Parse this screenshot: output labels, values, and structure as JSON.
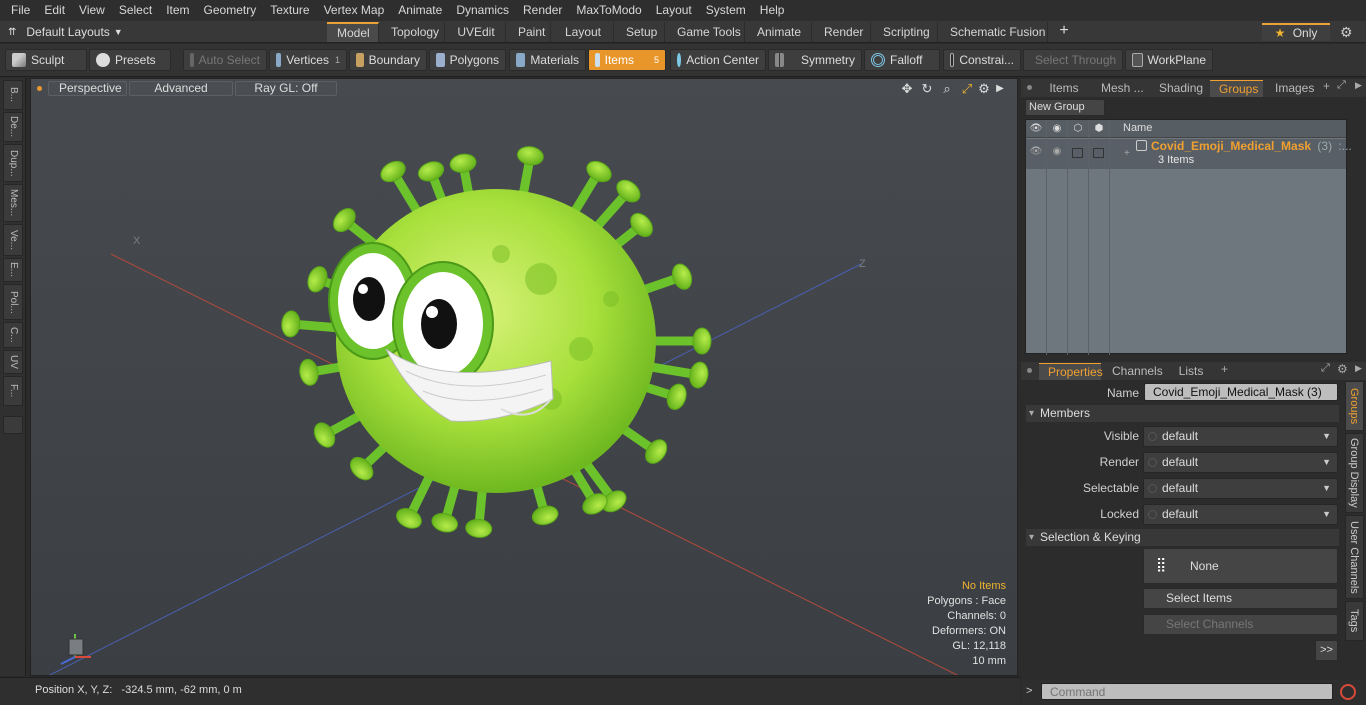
{
  "menu": [
    "File",
    "Edit",
    "View",
    "Select",
    "Item",
    "Geometry",
    "Texture",
    "Vertex Map",
    "Animate",
    "Dynamics",
    "Render",
    "MaxToModo",
    "Layout",
    "System",
    "Help"
  ],
  "layouts": {
    "label": "Default Layouts"
  },
  "layout_tabs": [
    "Model",
    "Topology",
    "UVEdit",
    "Paint",
    "Layout",
    "Setup",
    "Game Tools",
    "Animate",
    "Render",
    "Scripting",
    "Schematic Fusion"
  ],
  "only_label": "Only",
  "toolbar": {
    "sculpt": "Sculpt",
    "presets": "Presets",
    "auto_select": "Auto Select",
    "vertices": "Vertices",
    "vertices_count": "1",
    "boundary": "Boundary",
    "polygons": "Polygons",
    "materials": "Materials",
    "items": "Items",
    "items_count": "5",
    "action_center": "Action Center",
    "symmetry": "Symmetry",
    "falloff": "Falloff",
    "constraints": "Constrai...",
    "select_through": "Select Through",
    "workplane": "WorkPlane"
  },
  "left_tabs": [
    "B...",
    "De...",
    "Dup...",
    "Mes...",
    "Ve...",
    "E...",
    "Pol...",
    "C...",
    "UV",
    "F..."
  ],
  "viewport": {
    "perspective": "Perspective",
    "advanced": "Advanced",
    "raygl": "Ray GL: Off",
    "stats": {
      "items": "No Items",
      "polygons": "Polygons : Face",
      "channels": "Channels: 0",
      "deformers": "Deformers: ON",
      "gl": "GL: 12,118",
      "scale": "10 mm"
    }
  },
  "status": {
    "position": "Position X, Y, Z:   -324.5 mm, -62 mm, 0 m"
  },
  "right": {
    "top_tabs": [
      "Items",
      "Mesh ...",
      "Shading",
      "Groups",
      "Images"
    ],
    "new_group": "New Group",
    "col_name": "Name",
    "group": {
      "name": "Covid_Emoji_Medical_Mask",
      "count": "(3)",
      "suffix": ":...",
      "items": "3 Items"
    },
    "prop_tabs": [
      "Properties",
      "Channels",
      "Lists"
    ],
    "name_label": "Name",
    "name_value": "Covid_Emoji_Medical_Mask (3)",
    "members": "Members",
    "fields": [
      {
        "label": "Visible",
        "value": "default"
      },
      {
        "label": "Render",
        "value": "default"
      },
      {
        "label": "Selectable",
        "value": "default"
      },
      {
        "label": "Locked",
        "value": "default"
      }
    ],
    "sel_keying": "Selection & Keying",
    "none": "None",
    "select_items": "Select Items",
    "select_channels": "Select Channels",
    "more": ">>",
    "side_tabs": [
      "Groups",
      "Group Display",
      "User Channels",
      "Tags"
    ],
    "command_placeholder": "Command"
  },
  "colors": {
    "accent": "#e8962a",
    "virus": "#8fd130"
  }
}
